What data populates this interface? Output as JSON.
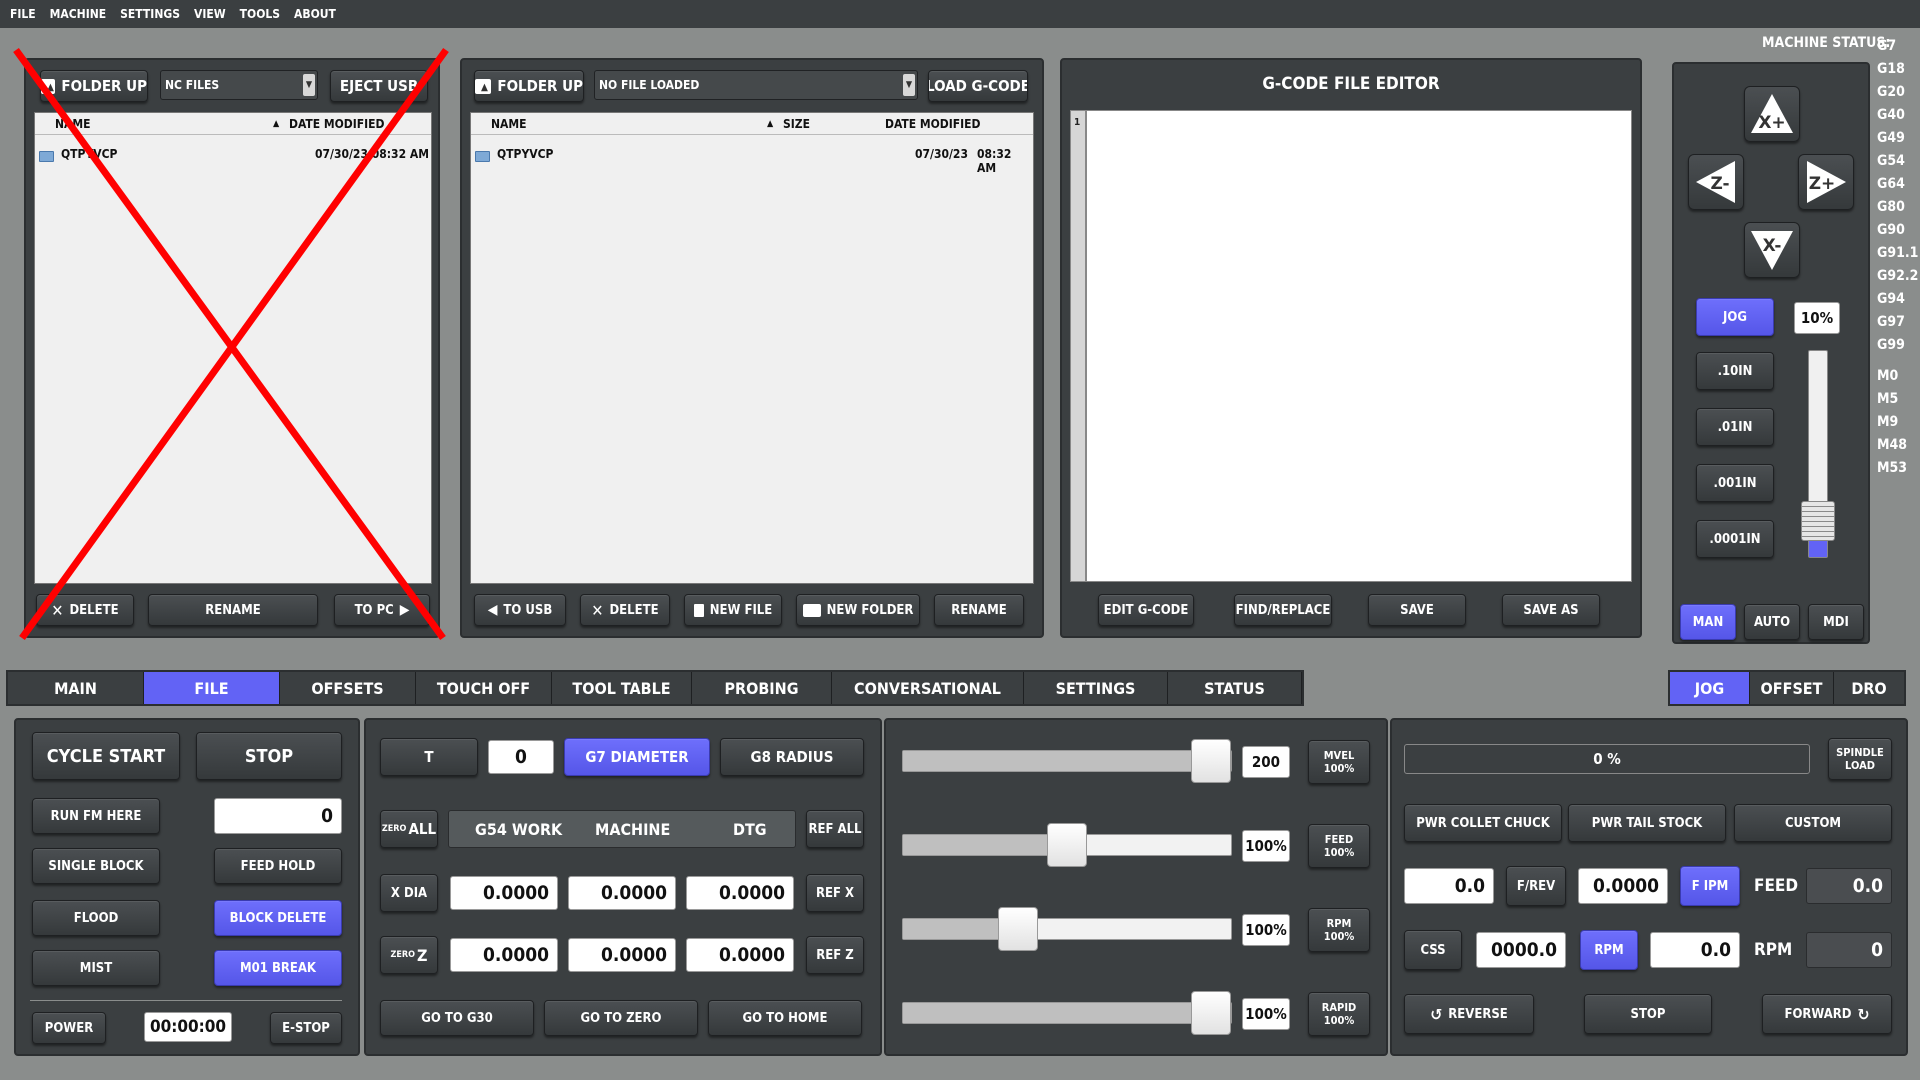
{
  "menu": [
    "FILE",
    "MACHINE",
    "SETTINGS",
    "VIEW",
    "TOOLS",
    "ABOUT"
  ],
  "usb": {
    "folder_up": "FOLDER UP",
    "combo": "NC FILES",
    "eject": "EJECT USB",
    "col_name": "NAME",
    "col_date": "DATE MODIFIED",
    "row_name": "QTPYVCP",
    "row_date": "07/30/23 08:32 AM",
    "delete": "DELETE",
    "rename": "RENAME",
    "to_pc": "TO PC"
  },
  "local": {
    "folder_up": "FOLDER UP",
    "combo": "NO FILE LOADED",
    "load": "LOAD G-CODE",
    "col_name": "NAME",
    "col_size": "SIZE",
    "col_date": "DATE MODIFIED",
    "row_name": "QTPYVCP",
    "row_date": "07/30/23",
    "row_time": "08:32 AM",
    "to_usb": "TO USB",
    "delete": "DELETE",
    "new_file": "NEW FILE",
    "new_folder": "NEW FOLDER",
    "rename": "RENAME"
  },
  "editor": {
    "title": "G-CODE FILE EDITOR",
    "line1": "1",
    "edit": "EDIT G-CODE",
    "find": "FIND/REPLACE",
    "save": "SAVE",
    "save_as": "SAVE AS"
  },
  "status": {
    "label": "MACHINE STATUS:",
    "gcodes": [
      "G7",
      "G18",
      "G20",
      "G40",
      "G49",
      "G54",
      "G64",
      "G80",
      "G90",
      "G91.1",
      "G92.2",
      "G94",
      "G97",
      "G99"
    ],
    "mcodes": [
      "M0",
      "M5",
      "M9",
      "M48",
      "M53"
    ]
  },
  "jog": {
    "xplus": "X+",
    "xminus": "X-",
    "zminus": "Z-",
    "zplus": "Z+",
    "jog": "JOG",
    "pct": "10%",
    "inc1": ".10IN",
    "inc2": ".01IN",
    "inc3": ".001IN",
    "inc4": ".0001IN",
    "man": "MAN",
    "auto": "AUTO",
    "mdi": "MDI"
  },
  "tabs": [
    "MAIN",
    "FILE",
    "OFFSETS",
    "TOUCH OFF",
    "TOOL TABLE",
    "PROBING",
    "CONVERSATIONAL",
    "SETTINGS",
    "STATUS"
  ],
  "right_tabs": [
    "JOG",
    "OFFSET",
    "DRO"
  ],
  "run": {
    "cycle_start": "CYCLE START",
    "stop": "STOP",
    "run_fm_here": "RUN FM HERE",
    "line_val": "0",
    "single_block": "SINGLE BLOCK",
    "feed_hold": "FEED HOLD",
    "flood": "FLOOD",
    "block_delete": "BLOCK DELETE",
    "mist": "MIST",
    "m01": "M01 BREAK",
    "power": "POWER",
    "timer": "00:00:00",
    "estop": "E-STOP"
  },
  "dro": {
    "t": "T",
    "t_val": "0",
    "g7": "G7  DIAMETER",
    "g8": "G8  RADIUS",
    "zero": "ZERO",
    "all": "ALL",
    "g54": "G54 WORK",
    "machine": "MACHINE",
    "dtg": "DTG",
    "ref_all": "REF ALL",
    "x_dia": "X DIA",
    "x_work": "0.0000",
    "x_mach": "0.0000",
    "x_dtg": "0.0000",
    "ref_x": "REF X",
    "z": "Z",
    "z_work": "0.0000",
    "z_mach": "0.0000",
    "z_dtg": "0.0000",
    "ref_z": "REF Z",
    "go_g30": "GO TO G30",
    "go_zero": "GO TO ZERO",
    "go_home": "GO TO HOME"
  },
  "overrides": {
    "mvel_val": "200",
    "mvel_l1": "MVEL",
    "mvel_l2": "100%",
    "mvel_frac": 0.94,
    "feed_val": "100%",
    "feed_l1": "FEED",
    "feed_l2": "100%",
    "feed_frac": 0.5,
    "rpm_val": "100%",
    "rpm_l1": "RPM",
    "rpm_l2": "100%",
    "rpm_frac": 0.35,
    "rapid_val": "100%",
    "rapid_l1": "RAPID",
    "rapid_l2": "100%",
    "rapid_frac": 0.94
  },
  "spindle": {
    "load_pct": "0 %",
    "load_l1": "SPINDLE",
    "load_l2": "LOAD",
    "collet": "PWR COLLET CHUCK",
    "tail": "PWR TAIL STOCK",
    "custom": "CUSTOM",
    "frev_val": "0.0",
    "frev": "F/REV",
    "fipm_val": "0.0000",
    "fipm": "F IPM",
    "feed": "FEED",
    "feed_val": "0.0",
    "css": "CSS",
    "css_val": "0000.0",
    "rpm_btn": "RPM",
    "rpm_val": "0.0",
    "rpm": "RPM",
    "rpm_actual": "0",
    "reverse": "REVERSE",
    "stop": "STOP",
    "forward": "FORWARD"
  },
  "colors": {
    "accent": "#6263f5",
    "panel": "#3b3f41",
    "background": "#8a8d8c",
    "cross": "#ff0000"
  }
}
